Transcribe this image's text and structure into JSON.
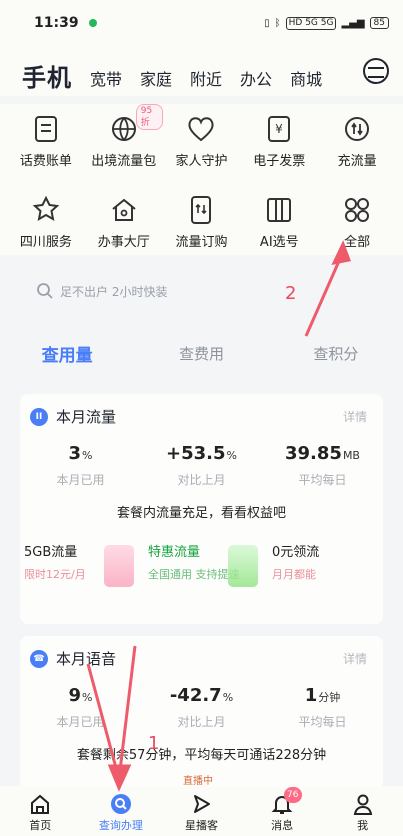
{
  "status_bar": {
    "time": "11:39",
    "indicators": "HD 5G 5G",
    "battery": "85"
  },
  "top_nav": {
    "active": "手机",
    "items": [
      "宽带",
      "家庭",
      "附近",
      "办公",
      "商城"
    ]
  },
  "services": [
    {
      "label": "话费账单",
      "icon": "bill-icon"
    },
    {
      "label": "出境流量包",
      "icon": "globe-data-icon",
      "badge": "95折"
    },
    {
      "label": "家人守护",
      "icon": "heart-shield-icon"
    },
    {
      "label": "电子发票",
      "icon": "invoice-yen-icon"
    },
    {
      "label": "充流量",
      "icon": "recharge-icon"
    },
    {
      "label": "四川服务",
      "icon": "star-service-icon"
    },
    {
      "label": "办事大厅",
      "icon": "home-hall-icon"
    },
    {
      "label": "流量订购",
      "icon": "phone-order-icon"
    },
    {
      "label": "AI选号",
      "icon": "ai-number-icon"
    },
    {
      "label": "全部",
      "icon": "all-grid-icon"
    }
  ],
  "search": {
    "placeholder": "足不出户 2小时快装"
  },
  "tabs": [
    "查用量",
    "查费用",
    "查积分"
  ],
  "flow_card": {
    "title": "本月流量",
    "detail": "详情",
    "stats": [
      {
        "value": "3",
        "unit": "%",
        "label": "本月已用"
      },
      {
        "value": "+53.5",
        "unit": "%",
        "label": "对比上月"
      },
      {
        "value": "39.85",
        "unit": "MB",
        "label": "平均每日"
      }
    ],
    "message": "套餐内流量充足，看看权益吧",
    "promos": [
      {
        "title": "5GB流量",
        "subtitle": "限时12元/月"
      },
      {
        "title": "特惠流量",
        "subtitle": "全国通用 支持提速"
      },
      {
        "title": "0元领流",
        "subtitle": "月月都能"
      }
    ]
  },
  "voice_card": {
    "title": "本月语音",
    "detail": "详情",
    "stats": [
      {
        "value": "9",
        "unit": "%",
        "label": "本月已用"
      },
      {
        "value": "-42.7",
        "unit": "%",
        "label": "对比上月"
      },
      {
        "value": "1",
        "unit": "分钟",
        "label": "平均每日"
      }
    ],
    "message": "套餐剩余57分钟，平均每天可通话228分钟",
    "live_tag": "直播中"
  },
  "bottom_tabs": [
    {
      "label": "首页",
      "icon": "home-icon"
    },
    {
      "label": "查询办理",
      "icon": "query-icon"
    },
    {
      "label": "星播客",
      "icon": "play-icon"
    },
    {
      "label": "消息",
      "icon": "bell-icon",
      "badge": "76"
    },
    {
      "label": "我",
      "icon": "user-icon"
    }
  ],
  "annotations": {
    "label_1": "1",
    "label_2": "2"
  },
  "colors": {
    "accent": "#4a7ef7",
    "annotation": "#e84b5d",
    "green": "#17a33e",
    "pink": "#ec8f9a"
  }
}
